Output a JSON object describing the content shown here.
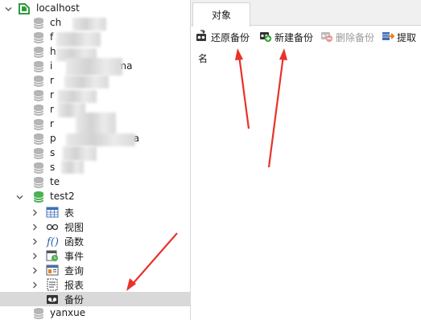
{
  "tree": {
    "connection_label": "localhost",
    "databases_visible": [
      {
        "label": "ch"
      },
      {
        "label": "f"
      },
      {
        "label": "h"
      },
      {
        "label": "i",
        "suffix": "ema"
      },
      {
        "label": "r"
      },
      {
        "label": "r"
      },
      {
        "label": "r",
        "suffix": "n"
      },
      {
        "label": "r"
      },
      {
        "label": "p",
        "suffix": "ma"
      },
      {
        "label": "s"
      },
      {
        "label": "s"
      },
      {
        "label": "te"
      }
    ],
    "open_database": "test2",
    "children": [
      {
        "label": "表",
        "icon": "table-icon"
      },
      {
        "label": "视图",
        "icon": "view-icon"
      },
      {
        "label": "函数",
        "icon": "function-icon"
      },
      {
        "label": "事件",
        "icon": "event-icon"
      },
      {
        "label": "查询",
        "icon": "query-icon"
      },
      {
        "label": "报表",
        "icon": "report-icon"
      },
      {
        "label": "备份",
        "icon": "backup-icon",
        "selected": true
      }
    ],
    "last_database": "yanxue"
  },
  "pane": {
    "tab_label": "对象",
    "toolbar": {
      "restore_label": "还原备份",
      "new_label": "新建备份",
      "delete_label": "删除备份",
      "extract_label": "提取"
    },
    "column_header": "名"
  },
  "colors": {
    "db_icon": "#b4b4b4",
    "db_icon_open": "#4caf50",
    "connection_icon": "#2e9c3e",
    "selected_row": "#d9d9d9",
    "arrow": "#e8322a"
  }
}
